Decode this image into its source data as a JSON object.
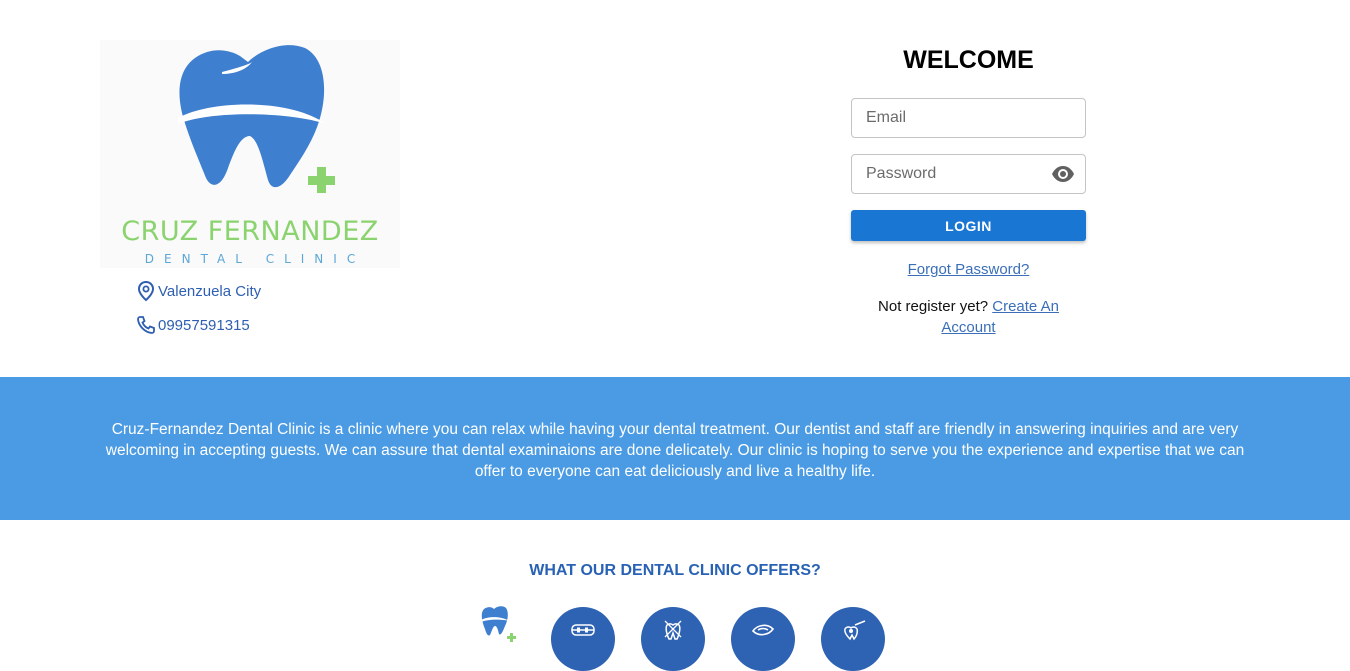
{
  "logo": {
    "title": "CRUZ FERNANDEZ",
    "subtitle": "DENTAL CLINIC",
    "colors": {
      "tooth": "#3f7fcf",
      "plus": "#8ad36e",
      "title": "#8ad36e",
      "subtitle": "#5aa7d8"
    }
  },
  "contact": {
    "location_icon": "location-pin-icon",
    "location": "Valenzuela City",
    "phone_icon": "phone-icon",
    "phone": "09957591315"
  },
  "login": {
    "heading": "WELCOME",
    "email_placeholder": "Email",
    "password_placeholder": "Password",
    "toggle_icon": "eye-icon",
    "login_button": "LOGIN",
    "forgot_link": "Forgot Password?",
    "register_prompt": "Not register yet?",
    "register_link": "Create An Account"
  },
  "about": {
    "text": "Cruz-Fernandez Dental Clinic is a clinic where you can relax while having your dental treatment. Our dentist and staff are friendly in answering inquiries and are very welcoming in accepting guests. We can assure that dental examinaions are done delicately. Our clinic is hoping to serve you the experience and expertise that we can offer to everyone can eat deliciously and live a healthy life."
  },
  "offers": {
    "heading": "WHAT OUR DENTAL CLINIC OFFERS?",
    "icons": [
      "tooth-logo-icon",
      "braces-icon",
      "tooth-extraction-icon",
      "dental-cleaning-icon",
      "dental-filling-icon"
    ]
  },
  "colors": {
    "primary": "#1976d2",
    "band": "#4a9be3",
    "accent_text": "#2962b5",
    "link": "#3a6fb8"
  }
}
